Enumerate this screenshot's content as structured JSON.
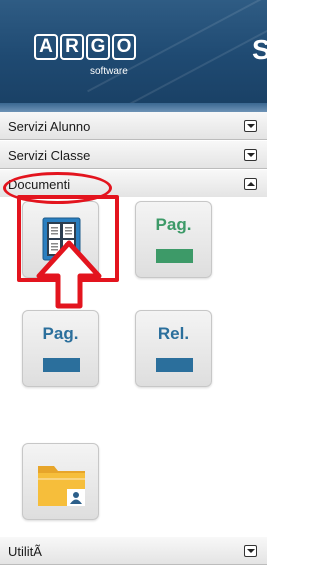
{
  "header": {
    "logo_letters": [
      "A",
      "R",
      "G",
      "O"
    ],
    "logo_sub": "software",
    "partial_title_letter": "S"
  },
  "menu": {
    "sections": [
      {
        "label": "Servizi Alunno",
        "state": "collapsed"
      },
      {
        "label": "Servizi Classe",
        "state": "collapsed"
      },
      {
        "label": "Documenti",
        "state": "expanded"
      },
      {
        "label": "UtilitÃ",
        "state": "collapsed"
      }
    ]
  },
  "tiles": [
    {
      "icon": "bulletin-board-icon",
      "text": ""
    },
    {
      "icon": "pag-icon",
      "text": "Pag.",
      "bar_color": "#3d9a68"
    },
    {
      "icon": "pag-icon",
      "text": "Pag.",
      "bar_color": "#2b6f9c"
    },
    {
      "icon": "rel-icon",
      "text": "Rel.",
      "bar_color": "#2b6f9c"
    },
    {
      "icon": "folder-user-icon",
      "text": ""
    }
  ],
  "annotations": {
    "color": "#e3141e",
    "items": [
      "highlight-rectangle",
      "arrow-up",
      "ellipse-around-documenti"
    ]
  },
  "colors": {
    "header_bg": "#1f4a72",
    "tile_green_text": "#3d9a68",
    "tile_blue_text": "#2b6f9c"
  }
}
